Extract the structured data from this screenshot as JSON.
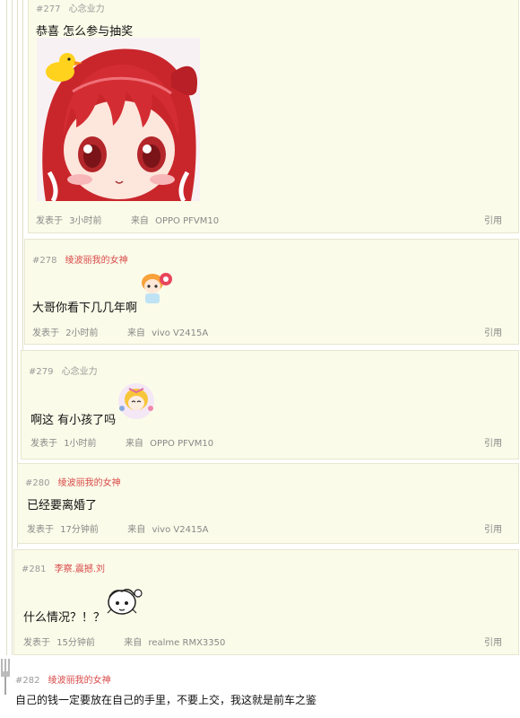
{
  "posts": [
    {
      "number": "#277",
      "author": "心念业力",
      "author_style": "gray",
      "content": "恭喜  怎么参与抽奖",
      "posted_label": "发表于",
      "time": "3小时前",
      "from_label": "来自",
      "device": "OPPO  PFVM10",
      "quote": "引用"
    },
    {
      "number": "#278",
      "author": "绫波丽我的女神",
      "author_style": "red",
      "content": "大哥你看下几几年啊",
      "posted_label": "发表于",
      "time": "2小时前",
      "from_label": "来自",
      "device": "vivo  V2415A",
      "quote": "引用"
    },
    {
      "number": "#279",
      "author": "心念业力",
      "author_style": "gray",
      "content": "啊这  有小孩了吗",
      "posted_label": "发表于",
      "time": "1小时前",
      "from_label": "来自",
      "device": "OPPO  PFVM10",
      "quote": "引用"
    },
    {
      "number": "#280",
      "author": "绫波丽我的女神",
      "author_style": "red",
      "content": "已经要离婚了",
      "posted_label": "发表于",
      "time": "17分钟前",
      "from_label": "来自",
      "device": "vivo  V2415A",
      "quote": "引用"
    },
    {
      "number": "#281",
      "author": "李察.震撼.刘",
      "author_style": "red",
      "content": "什么情况？！？",
      "posted_label": "发表于",
      "time": "15分钟前",
      "from_label": "来自",
      "device": "realme  RMX3350",
      "quote": "引用"
    },
    {
      "number": "#282",
      "author": "绫波丽我的女神",
      "author_style": "red",
      "content": "自己的钱一定要放在自己的手里，不要上交，我这就是前车之鉴"
    }
  ]
}
